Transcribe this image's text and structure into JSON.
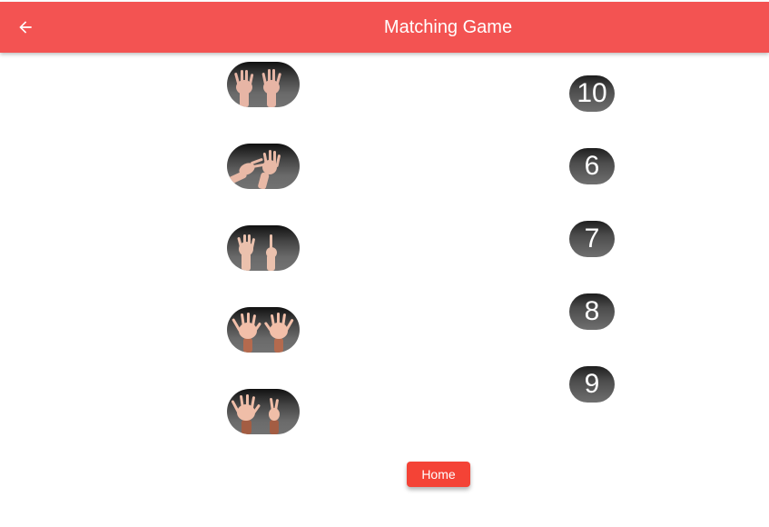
{
  "appbar": {
    "title": "Matching Game",
    "back_icon": "arrow-left-icon",
    "color": "#f35352"
  },
  "hand_cards": [
    {
      "name": "hand-sign-card-1",
      "description_icon": "hands-sign-icon"
    },
    {
      "name": "hand-sign-card-2",
      "description_icon": "hands-sign-icon"
    },
    {
      "name": "hand-sign-card-3",
      "description_icon": "hands-sign-icon"
    },
    {
      "name": "hand-sign-card-4",
      "description_icon": "hands-sign-icon"
    },
    {
      "name": "hand-sign-card-5",
      "description_icon": "hands-sign-icon"
    }
  ],
  "numbers": [
    "10",
    "6",
    "7",
    "8",
    "9"
  ],
  "home_button": {
    "label": "Home",
    "color": "#f44336"
  }
}
